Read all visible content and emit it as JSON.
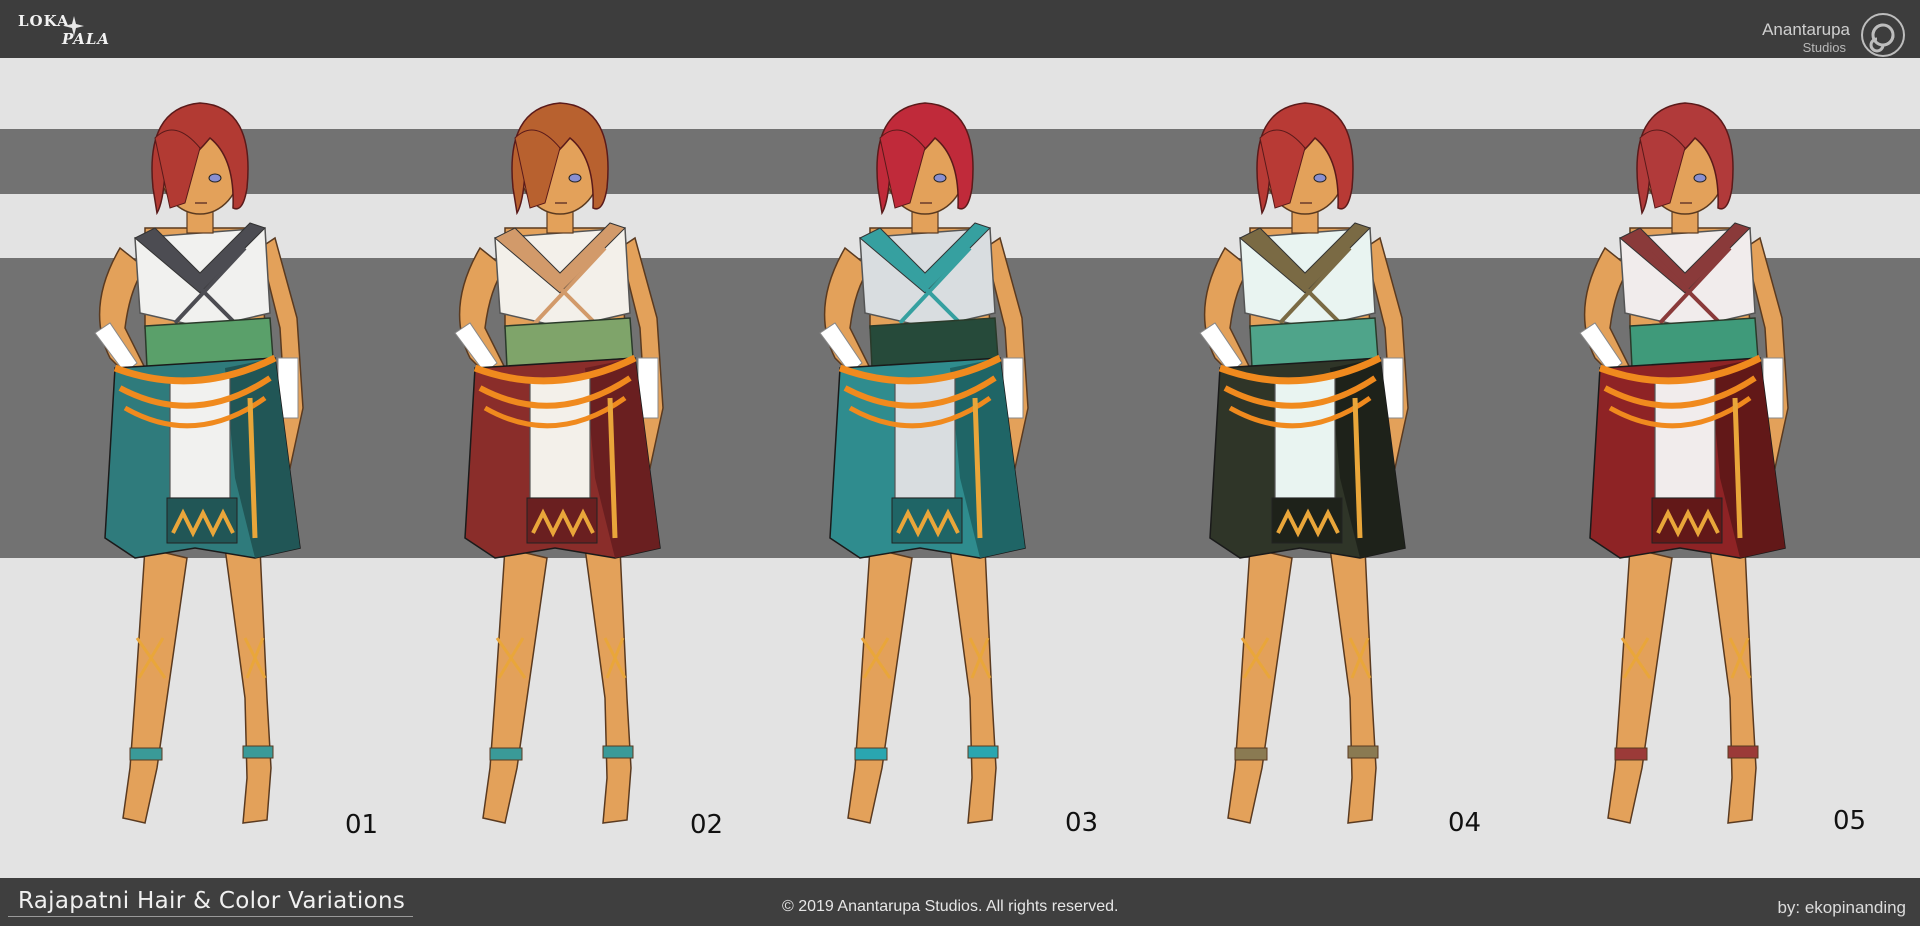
{
  "header": {
    "logo_line1": "LOKA",
    "logo_line2": "PALA",
    "studio_name": "Anantarupa",
    "studio_sub": "Studios"
  },
  "variants": [
    {
      "label": "01",
      "hair": "#b23a33",
      "trim": "#4c4c52",
      "sash": "#5aa06a",
      "skirt": "#2f7b7c",
      "skirtDark": "#215656",
      "top": "#f1f1ef",
      "band": "#3a9a98"
    },
    {
      "label": "02",
      "hair": "#b8612f",
      "trim": "#d29a6a",
      "sash": "#7fa46a",
      "skirt": "#8a2d2a",
      "skirtDark": "#6a1f20",
      "top": "#f3f0ea",
      "band": "#3a9a98"
    },
    {
      "label": "03",
      "hair": "#c02a3a",
      "trim": "#36a0a0",
      "sash": "#264a3a",
      "skirt": "#2f8c8e",
      "skirtDark": "#1f6566",
      "top": "#d9dde0",
      "band": "#2aa6b0"
    },
    {
      "label": "04",
      "hair": "#b83a35",
      "trim": "#7a6a44",
      "sash": "#4fa48a",
      "skirt": "#2f3528",
      "skirtDark": "#1e221a",
      "top": "#e9f4f1",
      "band": "#8a7a52"
    },
    {
      "label": "05",
      "hair": "#b13a3a",
      "trim": "#8a3a3a",
      "sash": "#3f9a7a",
      "skirt": "#8e2325",
      "skirtDark": "#621818",
      "top": "#f1ecec",
      "band": "#9b3a38"
    }
  ],
  "footer": {
    "title": "Rajapatni Hair & Color Variations",
    "copyright": "© 2019 Anantarupa Studios. All rights reserved.",
    "credit": "by: ekopinanding"
  }
}
